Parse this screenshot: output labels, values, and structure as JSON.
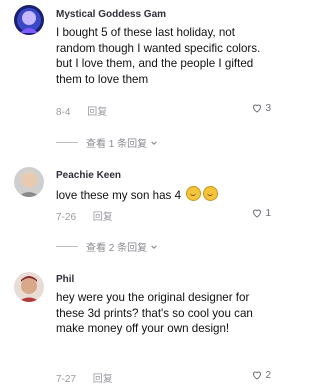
{
  "comments": [
    {
      "username": "Mystical Goddess Gam",
      "text": "I bought 5 of these last holiday, not random though I wanted specific colors. but I love them, and the people I gifted them to love them",
      "date": "8-4",
      "reply_label": "回复",
      "likes": "3",
      "view_replies": "查看 1 条回复"
    },
    {
      "username": "Peachie Keen",
      "text": "love these my son has 4",
      "date": "7-26",
      "reply_label": "回复",
      "likes": "1",
      "view_replies": "查看 2 条回复"
    },
    {
      "username": "Phil",
      "text": "hey were you the original designer for these 3d prints? that's so cool you can make money off your own design!",
      "date": "7-27",
      "reply_label": "回复",
      "likes": "2"
    }
  ],
  "icons": {
    "like": "heart-outline-icon",
    "expand": "chevron-down-icon",
    "emoji": "grinning-face-emoji"
  },
  "colors": {
    "meta_text": "#9a9aa2",
    "username_text": "#2f2f3a"
  }
}
